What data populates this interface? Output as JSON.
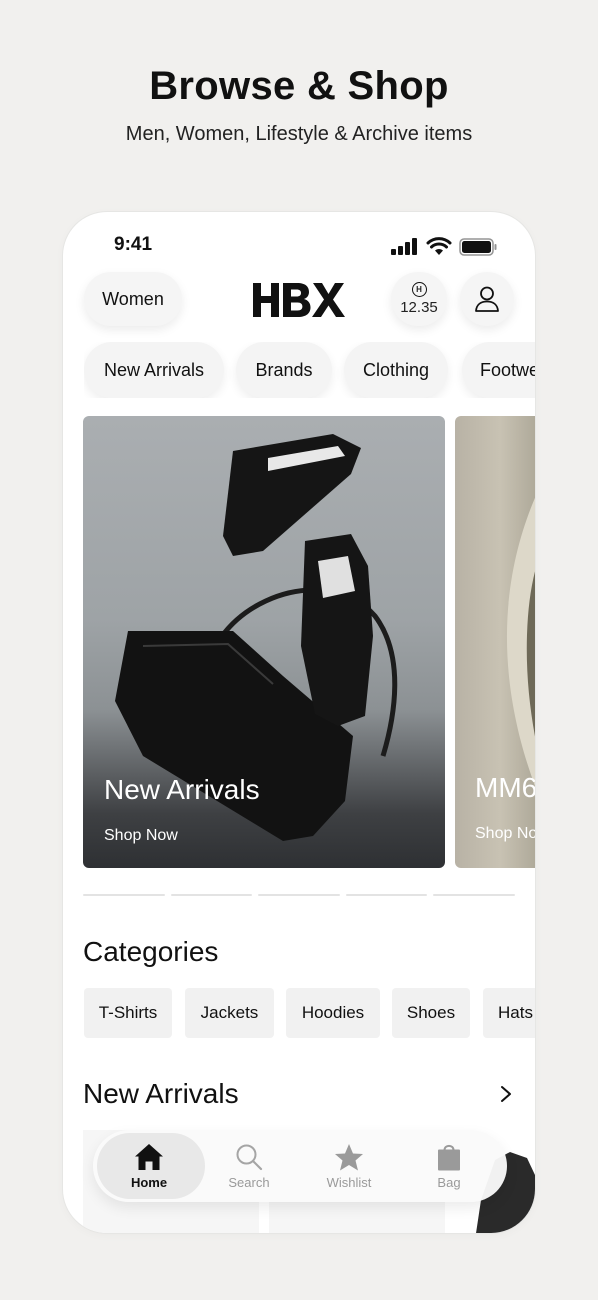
{
  "promo": {
    "title": "Browse & Shop",
    "subtitle": "Men, Women, Lifestyle & Archive items"
  },
  "status_bar": {
    "time": "9:41"
  },
  "header": {
    "gender": "Women",
    "logo_text": "HBX",
    "points": "12.35"
  },
  "nav_chips": [
    "New Arrivals",
    "Brands",
    "Clothing",
    "Footwe"
  ],
  "banners": [
    {
      "title": "New Arrivals",
      "cta": "Shop Now"
    },
    {
      "title": "MM6",
      "cta": "Shop Now"
    }
  ],
  "carousel_indicator_count": 5,
  "categories": {
    "title": "Categories",
    "items": [
      "T-Shirts",
      "Jackets",
      "Hoodies",
      "Shoes",
      "Hats"
    ]
  },
  "new_arrivals": {
    "title": "New Arrivals"
  },
  "tab_bar": {
    "active": "Home",
    "tabs": [
      {
        "label": "Home",
        "icon": "home-icon"
      },
      {
        "label": "Search",
        "icon": "search-icon"
      },
      {
        "label": "Wishlist",
        "icon": "star-icon"
      },
      {
        "label": "Bag",
        "icon": "bag-icon"
      }
    ]
  },
  "colors": {
    "page_background": "#f1f0ee",
    "phone_background": "#ffffff",
    "text": "#111111",
    "inactive_tab": "#9a9a9a"
  }
}
